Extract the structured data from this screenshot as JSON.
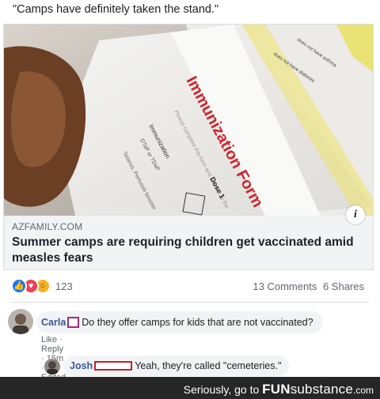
{
  "post": {
    "text": "\"Camps have definitely taken the stand.\""
  },
  "link_card": {
    "image_text": {
      "form_title": "Immunization Form",
      "line_1": "Please complete this form and return it to the",
      "line_2": "Immunization",
      "line_3": "DTaP or TDaP",
      "line_4": "Tetanus, Pertussis booster",
      "line_5": "Dose 1",
      "line_6": "does not have asthma",
      "line_7": "does not have diabetes"
    },
    "domain": "AZFAMILY.COM",
    "title": "Summer camps are requiring children get vaccinated amid measles fears",
    "info_icon": "info-icon"
  },
  "reactions": {
    "icons": [
      "like-icon",
      "love-icon",
      "wow-icon"
    ],
    "count": "123",
    "comments": "13 Comments",
    "shares": "6 Shares"
  },
  "comments": [
    {
      "author": "Carla",
      "text": "Do they offer camps for kids that are not vaccinated?",
      "actions": [
        "Like",
        "Reply"
      ],
      "time": "15m",
      "edited": "Edited"
    },
    {
      "author": "Josh",
      "text": "Yeah, they're called \"cemeteries.\""
    }
  ],
  "footer": {
    "prefix": "Seriously, go to",
    "brand_fun": "FUN",
    "brand_sub": "substance",
    "dotcom": ".com"
  },
  "colors": {
    "author": "#385898",
    "censor_box_1": "#a3287c",
    "censor_box_2": "#c2222b",
    "like": "#1877f2",
    "love": "#f33e58",
    "wow": "#f7b125",
    "footer_bg": "#262626"
  }
}
